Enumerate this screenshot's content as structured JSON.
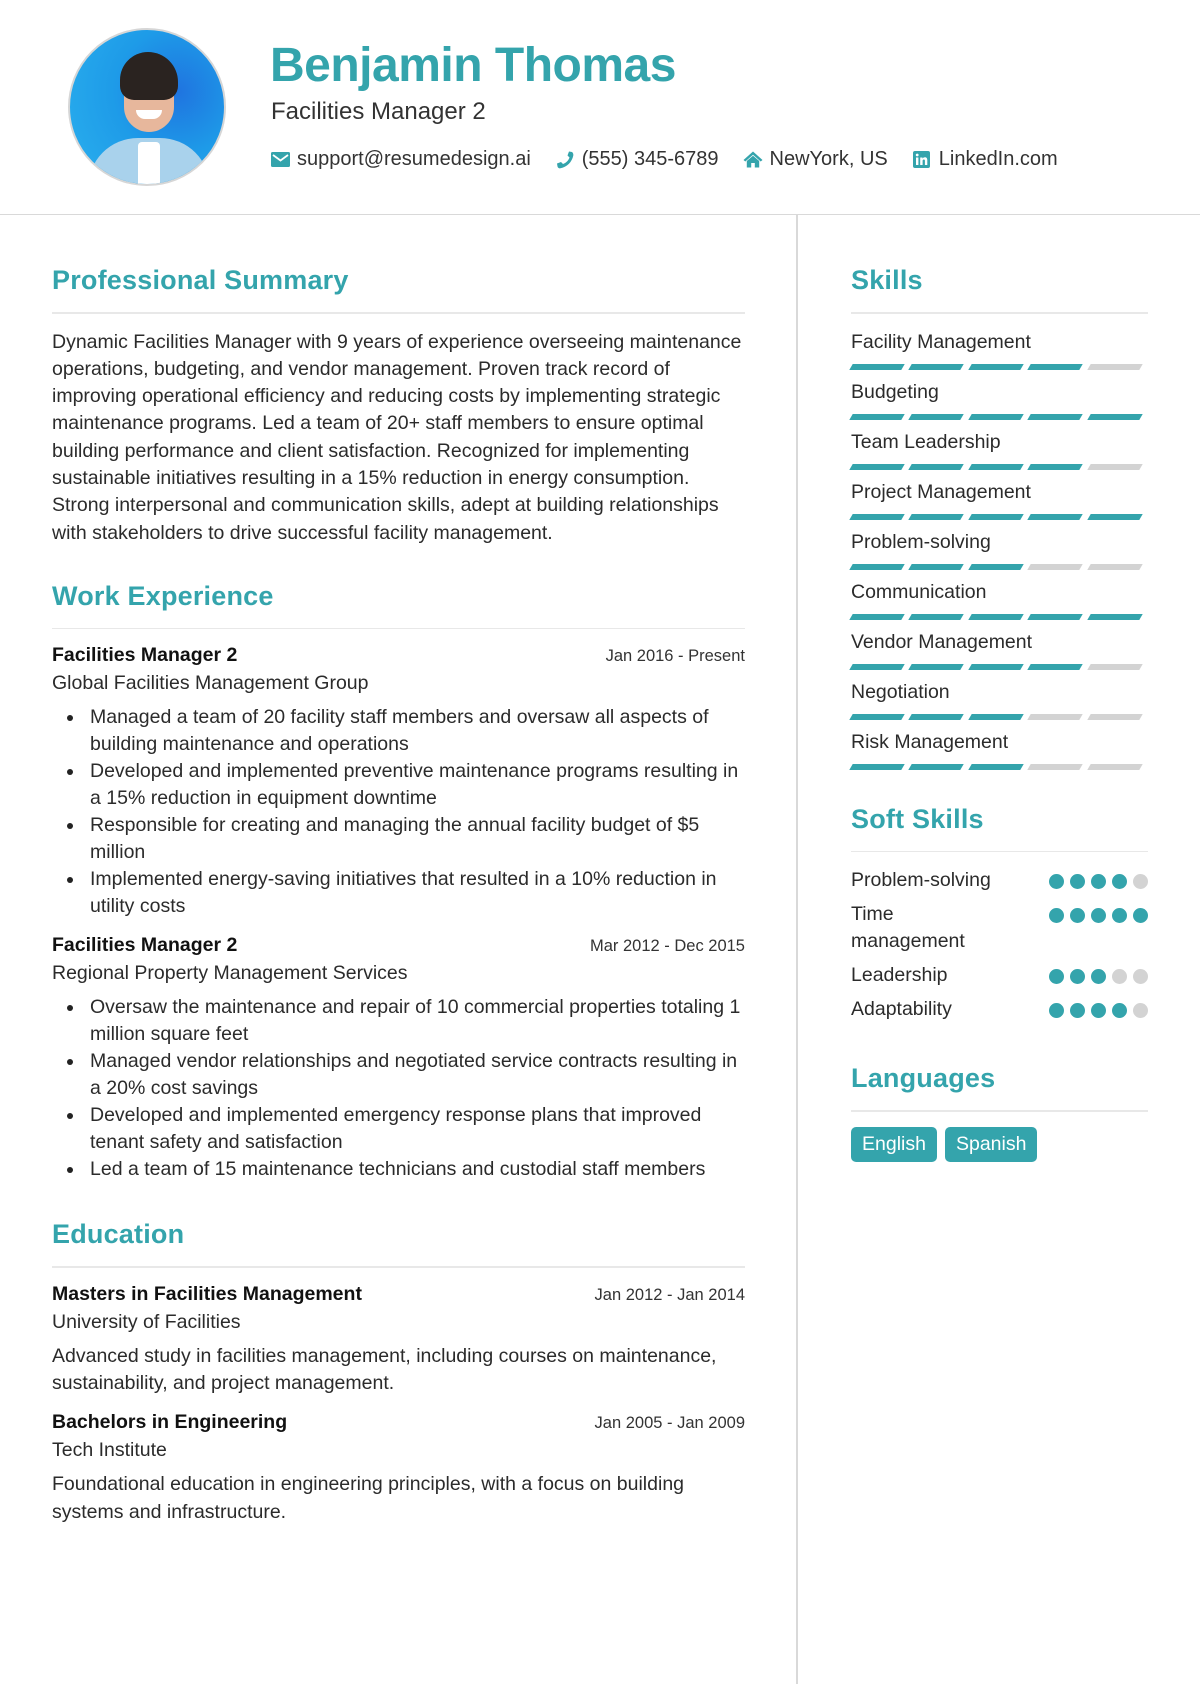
{
  "header": {
    "name": "Benjamin Thomas",
    "title": "Facilities Manager 2",
    "contacts": [
      {
        "icon": "envelope-icon",
        "text": "support@resumedesign.ai"
      },
      {
        "icon": "phone-icon",
        "text": "(555) 345-6789"
      },
      {
        "icon": "home-icon",
        "text": "NewYork, US"
      },
      {
        "icon": "linkedin-icon",
        "text": "LinkedIn.com"
      }
    ]
  },
  "colors": {
    "accent": "#34a4ac",
    "inactive": "#d3d3d3",
    "text": "#2b2b2b",
    "rule": "#e8e8e8"
  },
  "summary": {
    "heading": "Professional Summary",
    "text": "Dynamic Facilities Manager with 9 years of experience overseeing maintenance operations, budgeting, and vendor management. Proven track record of improving operational efficiency and reducing costs by implementing strategic maintenance programs. Led a team of 20+ staff members to ensure optimal building performance and client satisfaction. Recognized for implementing sustainable initiatives resulting in a 15% reduction in energy consumption. Strong interpersonal and communication skills, adept at building relationships with stakeholders to drive successful facility management."
  },
  "experience": {
    "heading": "Work Experience",
    "jobs": [
      {
        "title": "Facilities Manager 2",
        "dates": "Jan 2016 - Present",
        "company": "Global Facilities Management Group",
        "bullets": [
          "Managed a team of 20 facility staff members and oversaw all aspects of building maintenance and operations",
          "Developed and implemented preventive maintenance programs resulting in a 15% reduction in equipment downtime",
          "Responsible for creating and managing the annual facility budget of $5 million",
          "Implemented energy-saving initiatives that resulted in a 10% reduction in utility costs"
        ]
      },
      {
        "title": "Facilities Manager 2",
        "dates": "Mar 2012 - Dec 2015",
        "company": "Regional Property Management Services",
        "bullets": [
          "Oversaw the maintenance and repair of 10 commercial properties totaling 1 million square feet",
          "Managed vendor relationships and negotiated service contracts resulting in a 20% cost savings",
          "Developed and implemented emergency response plans that improved tenant safety and satisfaction",
          "Led a team of 15 maintenance technicians and custodial staff members"
        ]
      }
    ]
  },
  "education": {
    "heading": "Education",
    "items": [
      {
        "degree": "Masters in Facilities Management",
        "dates": "Jan 2012 - Jan 2014",
        "school": "University of Facilities",
        "description": "Advanced study in facilities management, including courses on maintenance, sustainability, and project management."
      },
      {
        "degree": "Bachelors in Engineering",
        "dates": "Jan 2005 - Jan 2009",
        "school": "Tech Institute",
        "description": "Foundational education in engineering principles, with a focus on building systems and infrastructure."
      }
    ]
  },
  "skills": {
    "heading": "Skills",
    "max": 5,
    "items": [
      {
        "name": "Facility Management",
        "level": 4
      },
      {
        "name": "Budgeting",
        "level": 5
      },
      {
        "name": "Team Leadership",
        "level": 4
      },
      {
        "name": "Project Management",
        "level": 5
      },
      {
        "name": "Problem-solving",
        "level": 3
      },
      {
        "name": "Communication",
        "level": 5
      },
      {
        "name": "Vendor Management",
        "level": 4
      },
      {
        "name": "Negotiation",
        "level": 3
      },
      {
        "name": "Risk Management",
        "level": 3
      }
    ]
  },
  "soft_skills": {
    "heading": "Soft Skills",
    "max": 5,
    "items": [
      {
        "name": "Problem-solving",
        "level": 4
      },
      {
        "name": "Time management",
        "level": 5
      },
      {
        "name": "Leadership",
        "level": 3
      },
      {
        "name": "Adaptability",
        "level": 4
      }
    ]
  },
  "languages": {
    "heading": "Languages",
    "items": [
      "English",
      "Spanish"
    ]
  }
}
